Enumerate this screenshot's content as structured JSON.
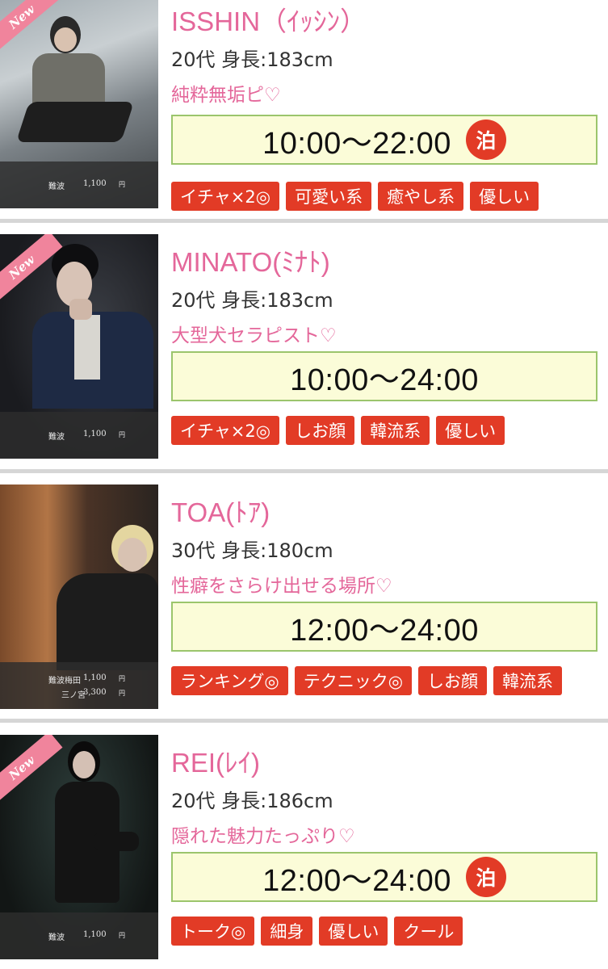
{
  "theme": {
    "accent_pink": "#e4679a",
    "tag_red": "#e23b26",
    "schedule_bg": "#fbfcd8",
    "schedule_border": "#9bc56c"
  },
  "cards": [
    {
      "name": "ISSHIN（ｲｯｼﾝ）",
      "meta": "20代 身長:183cm",
      "catch": "純粋無垢ピ♡",
      "schedule": "10:00〜22:00",
      "stay_badge": "泊",
      "new_badge": "New",
      "prices": [
        {
          "area": "難波",
          "price": "1,100",
          "unit": "円"
        }
      ],
      "tags": [
        "イチャ×2◎",
        "可愛い系",
        "癒やし系",
        "優しい"
      ]
    },
    {
      "name": "MINATO(ﾐﾅﾄ)",
      "meta": "20代 身長:183cm",
      "catch": "大型犬セラピスト♡",
      "schedule": "10:00〜24:00",
      "new_badge": "New",
      "prices": [
        {
          "area": "難波",
          "price": "1,100",
          "unit": "円"
        }
      ],
      "tags": [
        "イチャ×2◎",
        "しお顔",
        "韓流系",
        "優しい"
      ]
    },
    {
      "name": "TOA(ﾄｱ)",
      "meta": "30代 身長:180cm",
      "catch": "性癖をさらけ出せる場所♡",
      "schedule": "12:00〜24:00",
      "prices": [
        {
          "area": "難波梅田",
          "price": "1,100",
          "unit": "円"
        },
        {
          "area": "三ノ宮",
          "price": "3,300",
          "unit": "円"
        }
      ],
      "tags": [
        "ランキング◎",
        "テクニック◎",
        "しお顔",
        "韓流系"
      ]
    },
    {
      "name": "REI(ﾚｲ)",
      "meta": "20代 身長:186cm",
      "catch": "隠れた魅力たっぷり♡",
      "schedule": "12:00〜24:00",
      "stay_badge": "泊",
      "new_badge": "New",
      "prices": [
        {
          "area": "難波",
          "price": "1,100",
          "unit": "円"
        }
      ],
      "tags": [
        "トーク◎",
        "細身",
        "優しい",
        "クール"
      ]
    }
  ]
}
